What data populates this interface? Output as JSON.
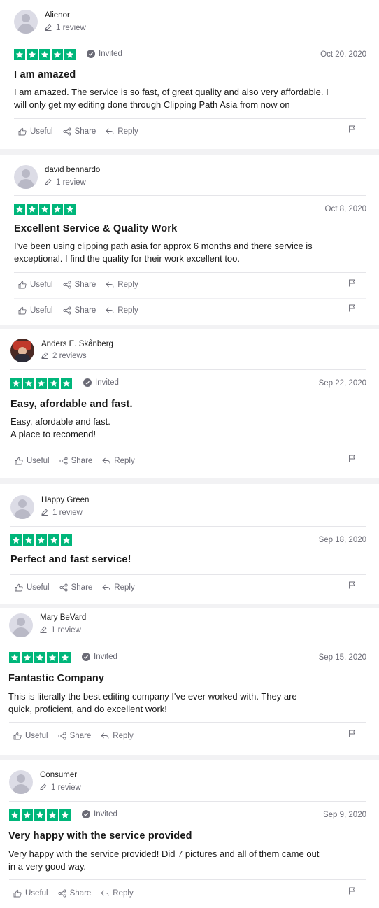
{
  "colors": {
    "star_green": "#00b67a",
    "muted": "#6b6b76",
    "divider": "#e5e5e9"
  },
  "icons": {
    "useful": "thumbs-up-icon",
    "share": "share-icon",
    "reply": "reply-icon",
    "flag": "flag-icon",
    "verified": "check-badge-icon",
    "count": "pencil-icon"
  },
  "actions": {
    "useful": "Useful",
    "share": "Share",
    "reply": "Reply"
  },
  "invited_label": "Invited",
  "reviews": [
    {
      "name": "Alienor",
      "count": "1 review",
      "rating": 5,
      "date": "Oct 20, 2020",
      "title": "I am amazed",
      "lines": [
        "I am amazed. The service is so fast, of great quality and also very affordable. I",
        "will only get my editing done through Clipping Path Asia from now on"
      ]
    },
    {
      "name": "david bennardo",
      "count": "1 review",
      "rating": 5,
      "date": "Oct 8, 2020",
      "title": "Excellent Service & Quality Work",
      "lines": [
        "I've been using clipping path asia for approx 6 months and there service is",
        "exceptional. I find the quality for their work excellent too."
      ]
    },
    {
      "name": "Anders E. Skånberg",
      "count": "2 reviews",
      "rating": 5,
      "date": "Sep 22, 2020",
      "title": "Easy, afordable and fast.",
      "lines": [
        "Easy, afordable and fast.",
        "A place to recomend!"
      ]
    },
    {
      "name": "Happy Green",
      "count": "1 review",
      "rating": 5,
      "date": "Sep 18, 2020",
      "title": "Perfect and fast service!",
      "lines": []
    },
    {
      "name": "Mary BeVard",
      "count": "1 review",
      "rating": 5,
      "date": "Sep 15, 2020",
      "title": "Fantastic Company",
      "lines": [
        "This is literally the best editing company I've ever worked with. They are",
        "quick, proficient, and do excellent work!"
      ]
    },
    {
      "name": "Consumer",
      "count": "1 review",
      "rating": 5,
      "date": "Sep 9, 2020",
      "title": "Very happy with the service provided",
      "lines": [
        "Very happy with the service provided! Did 7 pictures and all of them came out",
        "in a very good way."
      ]
    }
  ]
}
